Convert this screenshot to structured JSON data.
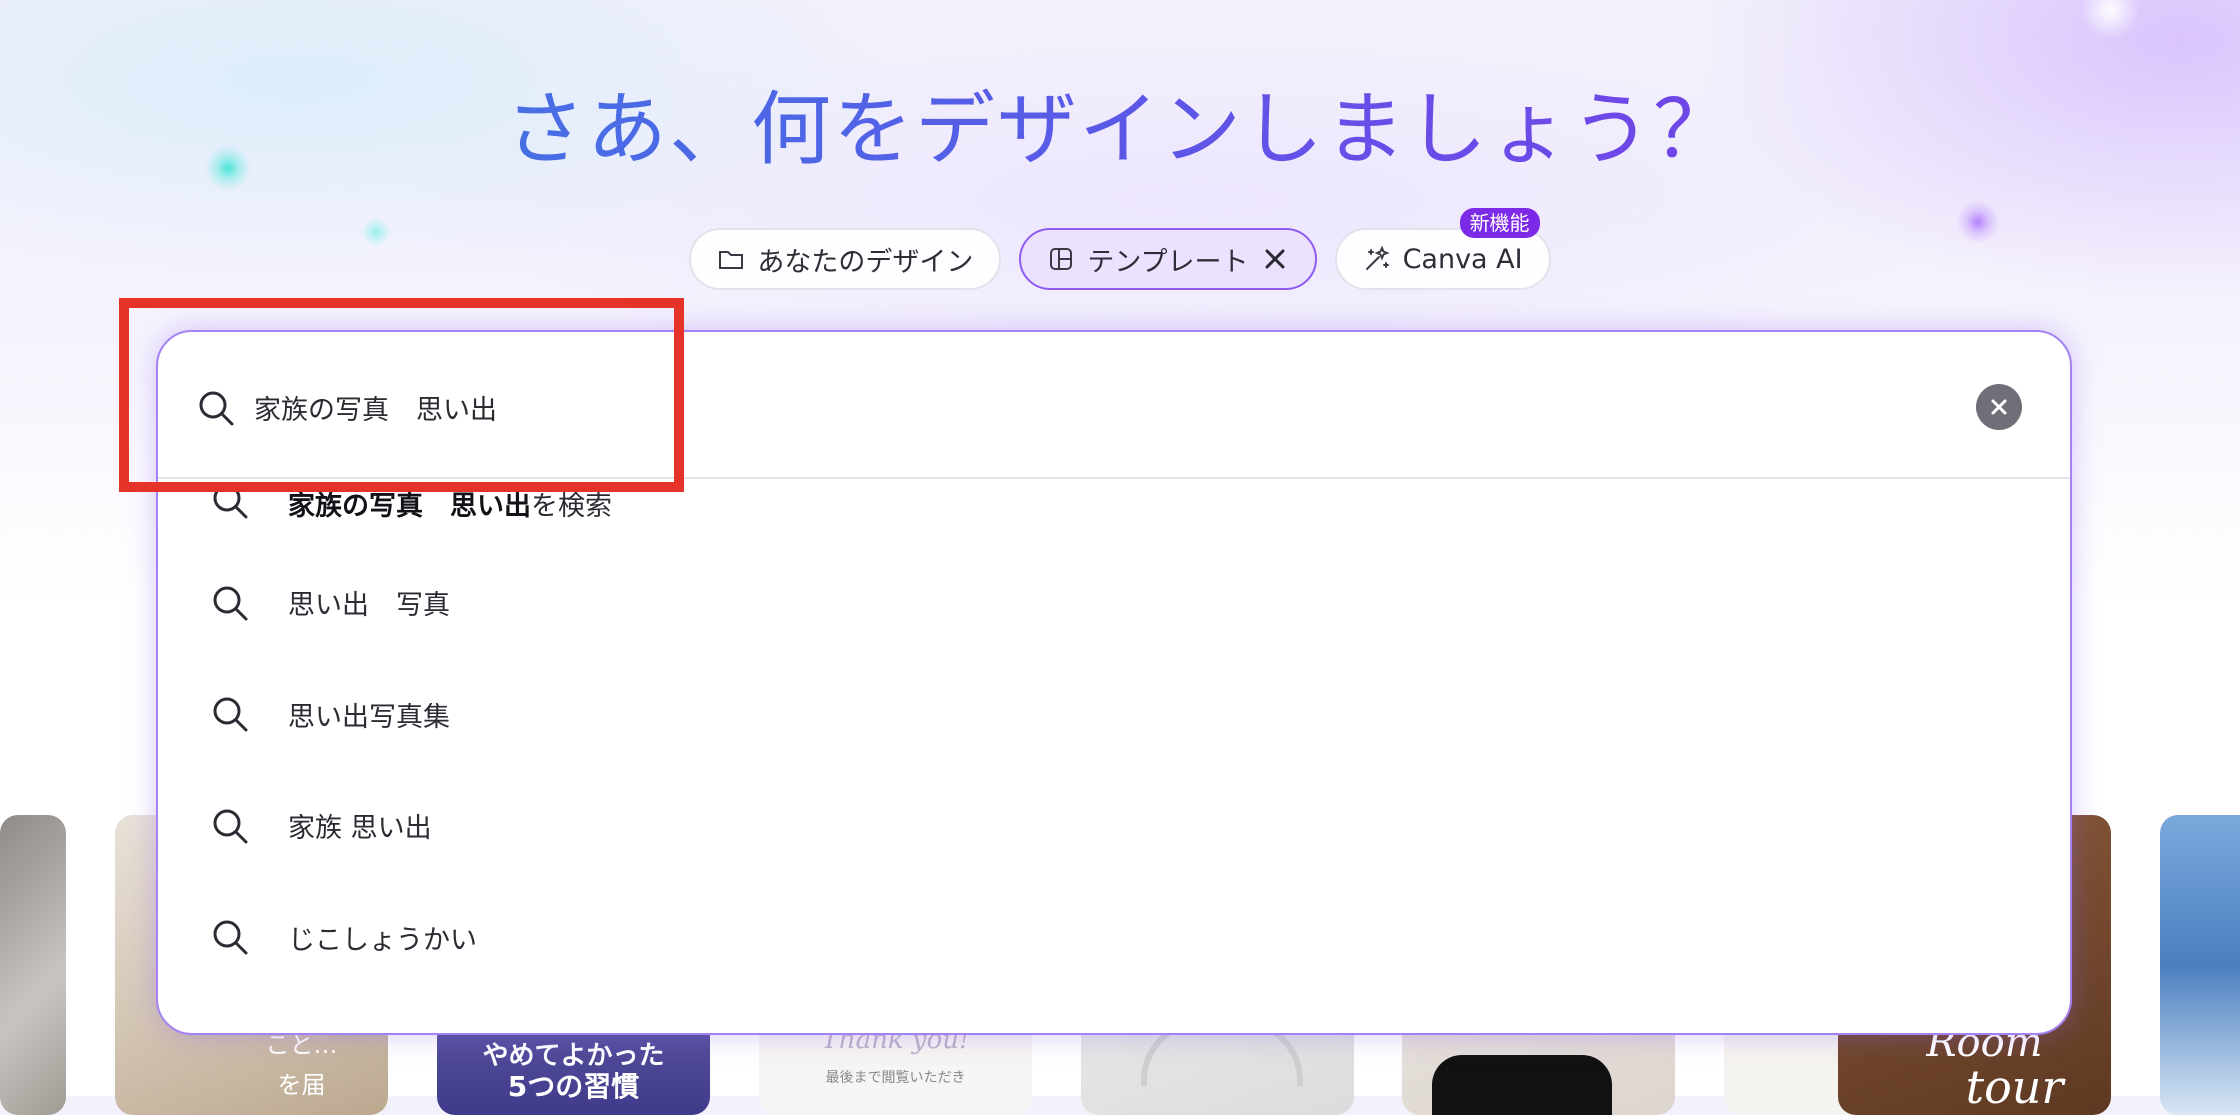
{
  "headline": "さあ、何をデザインしましょう？",
  "chips": [
    {
      "label": "あなたのデザイン",
      "icon": "folder-icon",
      "active": false
    },
    {
      "label": "テンプレート",
      "icon": "template-icon",
      "active": true
    },
    {
      "label": "Canva AI",
      "icon": "sparkle-icon",
      "active": false,
      "badge": "新機能"
    }
  ],
  "search": {
    "value": "家族の写真　思い出",
    "placeholder": ""
  },
  "suggestions": [
    {
      "bold": "家族の写真　思い出",
      "text": "を検索"
    },
    {
      "bold": "",
      "text": "思い出　写真"
    },
    {
      "bold": "",
      "text": "思い出写真集"
    },
    {
      "bold": "",
      "text": "家族 思い出"
    },
    {
      "bold": "",
      "text": "じこしょうかい"
    }
  ],
  "thumbnails": {
    "t2": {
      "line1": "こと…",
      "line2": "を届"
    },
    "t3": {
      "line1": "やめてよかった",
      "line2": "5つの習慣"
    },
    "t4": {
      "line1": "Thank you!",
      "line2": "最後まで閲覧いただき"
    },
    "t7": {
      "line1": "Room",
      "line2": "tour"
    }
  },
  "colors": {
    "accent": "#7d2ae8",
    "panel_border": "#a582f3",
    "highlight": "#e5332a"
  }
}
